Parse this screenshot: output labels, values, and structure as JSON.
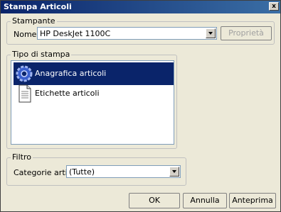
{
  "window": {
    "title": "Stampa Articoli",
    "close_glyph": "x"
  },
  "stampante": {
    "group_label": "Stampante",
    "name_label": "Nome:",
    "printer_value": "HP DeskJet 1100C",
    "properties_button": "Proprietà"
  },
  "tipo": {
    "group_label": "Tipo di stampa",
    "items": [
      {
        "label": "Anagrafica articoli",
        "icon": "gear-icon",
        "selected": true
      },
      {
        "label": "Etichette articoli",
        "icon": "document-icon",
        "selected": false
      }
    ]
  },
  "filtro": {
    "group_label": "Filtro",
    "category_label": "Categorie articoli:",
    "category_value": "(Tutte)"
  },
  "buttons": {
    "ok": "OK",
    "cancel": "Annulla",
    "preview": "Anteprima"
  }
}
